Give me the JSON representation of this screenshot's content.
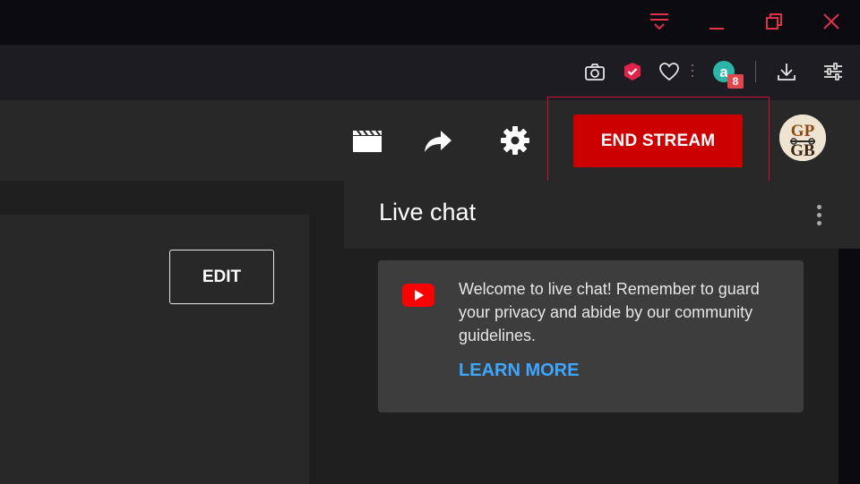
{
  "live_stream": {
    "end_stream_label": "END STREAM",
    "edit_label": "EDIT"
  },
  "avatar": {
    "initials_top": "GP",
    "initials_bottom": "GB"
  },
  "browser": {
    "extension_badge_count": "8"
  },
  "live_chat": {
    "title": "Live chat",
    "welcome_message": "Welcome to live chat! Remember to guard your privacy and abide by our community guidelines.",
    "learn_more_label": "LEARN MORE"
  },
  "colors": {
    "accent_red": "#cc0000",
    "link_blue": "#3ea6ff",
    "highlight_border": "#d0103a",
    "window_control_red": "#e0304a"
  }
}
